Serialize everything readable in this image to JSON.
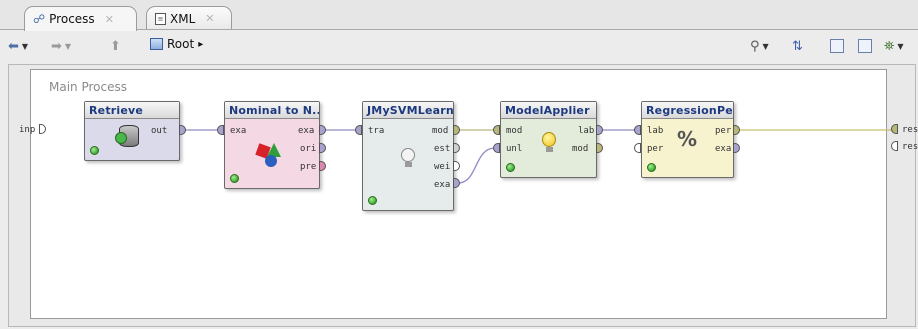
{
  "tabs": [
    {
      "label": "Process",
      "icon": "process-icon",
      "close": "✕"
    },
    {
      "label": "XML",
      "icon": "xml-icon",
      "close": "✕"
    }
  ],
  "toolbar": {
    "root_label": "Root",
    "root_arrow": "▸"
  },
  "canvas": {
    "title": "Main Process",
    "left_port": "inp",
    "right_ports": [
      "res",
      "res"
    ]
  },
  "operators": [
    {
      "name": "Retrieve",
      "inputs": [],
      "outputs": [
        "out"
      ],
      "color": "#dadaea"
    },
    {
      "name": "Nominal to N...",
      "inputs": [
        "exa"
      ],
      "outputs": [
        "exa",
        "ori",
        "pre"
      ],
      "color": "#f4d8e4"
    },
    {
      "name": "JMySVMLearner",
      "inputs": [
        "tra"
      ],
      "outputs": [
        "mod",
        "est",
        "wei",
        "exa"
      ],
      "color": "#e6ecec"
    },
    {
      "name": "ModelApplier",
      "inputs": [
        "mod",
        "unl"
      ],
      "outputs": [
        "lab",
        "mod"
      ],
      "color": "#e3ecdb"
    },
    {
      "name": "RegressionPe...",
      "inputs": [
        "lab",
        "per"
      ],
      "outputs": [
        "per",
        "exa"
      ],
      "color": "#f8f3cf"
    }
  ]
}
